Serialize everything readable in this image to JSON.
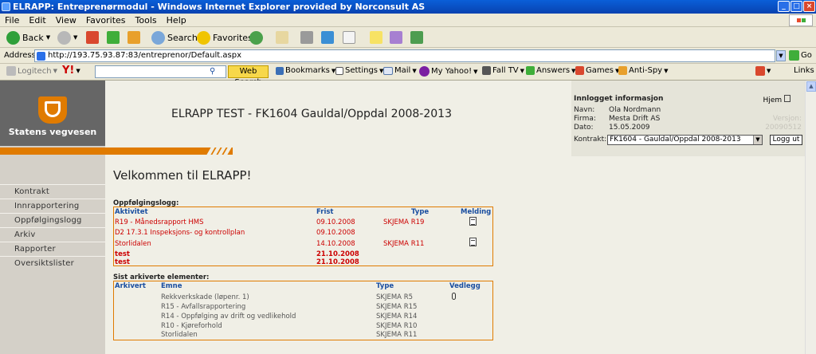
{
  "window": {
    "title": "ELRAPP: Entreprenørmodul - Windows Internet Explorer provided by Norconsult AS"
  },
  "menu": [
    "File",
    "Edit",
    "View",
    "Favorites",
    "Tools",
    "Help"
  ],
  "toolbar": {
    "back": "Back",
    "search": "Search",
    "favorites": "Favorites"
  },
  "address": {
    "label": "Address",
    "url": "http://193.75.93.87:83/entreprenor/Default.aspx",
    "go": "Go"
  },
  "linksbar": {
    "logitech": "Logitech",
    "yahoo": "Y!",
    "web_search": "Web Search",
    "bookmarks": "Bookmarks",
    "settings": "Settings",
    "mail": "Mail",
    "my_yahoo": "My Yahoo!",
    "fall_tv": "Fall TV",
    "answers": "Answers",
    "games": "Games",
    "anti_spy": "Anti-Spy",
    "links": "Links"
  },
  "brand": {
    "name": "Statens vegvesen"
  },
  "nav": [
    "Kontrakt",
    "Innrapportering",
    "Oppfølgingslogg",
    "Arkiv",
    "Rapporter",
    "Oversiktslister"
  ],
  "header": {
    "title": "ELRAPP TEST - FK1604 Gauldal/Oppdal 2008-2013"
  },
  "info": {
    "heading": "Innlogget informasjon",
    "help": "Hjem",
    "name_label": "Navn:",
    "name": "Ola Nordmann",
    "firm_label": "Firma:",
    "firm": "Mesta Drift AS",
    "date_label": "Dato:",
    "date": "15.05.2009",
    "contract_label": "Kontrakt:",
    "contract": "FK1604 - Gauldal/Oppdal 2008-2013",
    "version_label": "Versjon:",
    "version": "20090512",
    "logout": "Logg ut"
  },
  "welcome": "Velkommen til ELRAPP!",
  "followup": {
    "heading": "Oppfølgingslogg:",
    "columns": {
      "activity": "Aktivitet",
      "deadline": "Frist",
      "type": "Type",
      "message": "Melding"
    },
    "rows": [
      {
        "activity": "R19 - Månedsrapport HMS",
        "deadline": "09.10.2008",
        "type": "SKJEMA R19",
        "message": true,
        "bold": false
      },
      {
        "activity": "D2 17.3.1 Inspeksjons- og kontrollplan",
        "deadline": "09.10.2008",
        "type": "",
        "message": false,
        "bold": false
      },
      {
        "activity": "Storlidalen",
        "deadline": "14.10.2008",
        "type": "SKJEMA R11",
        "message": true,
        "bold": false
      },
      {
        "activity": "test",
        "deadline": "21.10.2008",
        "type": "",
        "message": false,
        "bold": true
      },
      {
        "activity": "test",
        "deadline": "21.10.2008",
        "type": "",
        "message": false,
        "bold": true
      }
    ]
  },
  "archived": {
    "heading": "Sist arkiverte elementer:",
    "columns": {
      "archived": "Arkivert",
      "subject": "Emne",
      "type": "Type",
      "attachment": "Vedlegg"
    },
    "rows": [
      {
        "subject": "Rekkverkskade (løpenr. 1)",
        "type": "SKJEMA R5",
        "attachment": true
      },
      {
        "subject": "R15 - Avfallsrapportering",
        "type": "SKJEMA R15",
        "attachment": false
      },
      {
        "subject": "R14 - Oppfølging av drift og vedlikehold",
        "type": "SKJEMA R14",
        "attachment": false
      },
      {
        "subject": "R10 - Kjøreforhold",
        "type": "SKJEMA R10",
        "attachment": false
      },
      {
        "subject": "Storlidalen",
        "type": "SKJEMA R11",
        "attachment": false
      }
    ]
  },
  "colors": {
    "accent": "#e07b00",
    "header_blue": "#1a4ea0",
    "alert_red": "#cc0000"
  }
}
